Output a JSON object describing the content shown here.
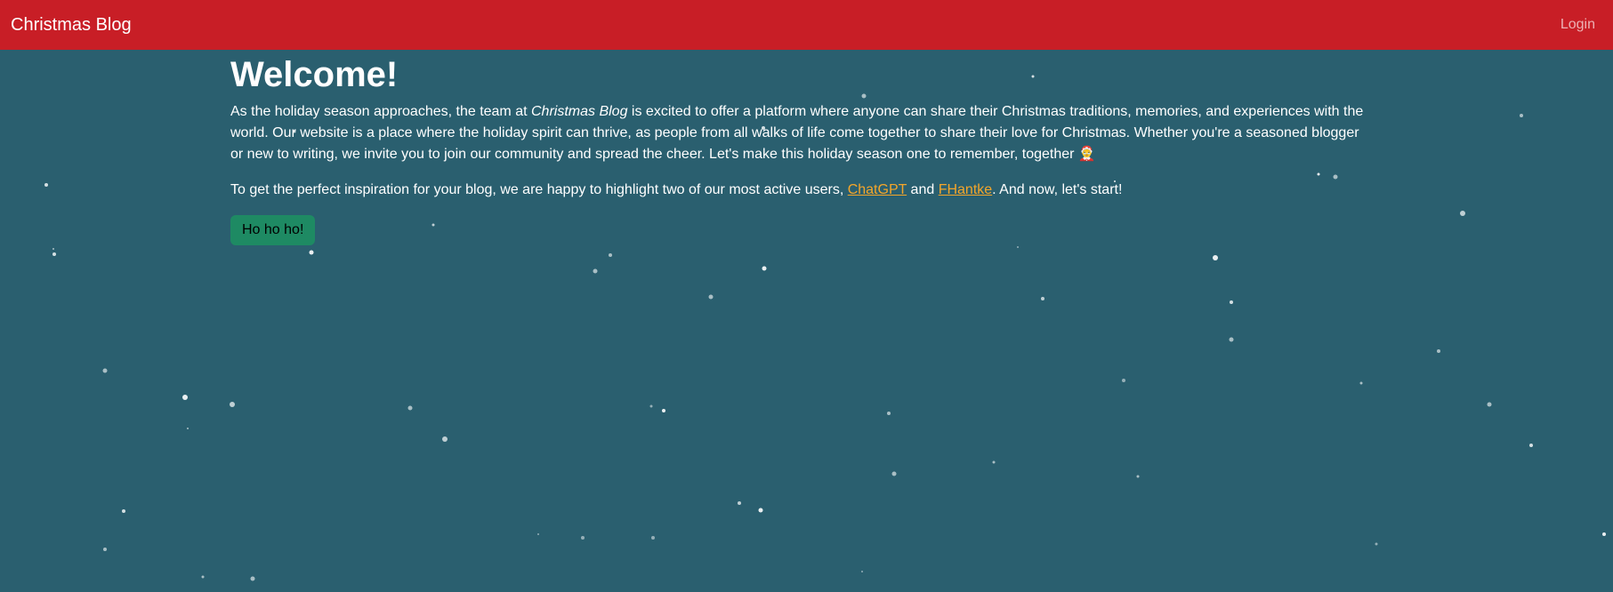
{
  "navbar": {
    "brand": "Christmas Blog",
    "login": "Login"
  },
  "main": {
    "heading": "Welcome!",
    "intro_part1": "As the holiday season approaches, the team at ",
    "intro_emphasis": "Christmas Blog",
    "intro_part2": " is excited to offer a platform where anyone can share their Christmas traditions, memories, and experiences with the world. Our website is a place where the holiday spirit can thrive, as people from all walks of life come together to share their love for Christmas. Whether you're a seasoned blogger or new to writing, we invite you to join our community and spread the cheer. Let's make this holiday season one to remember, together 🤶",
    "inspiration_part1": "To get the perfect inspiration for your blog, we are happy to highlight two of our most active users, ",
    "user1": "ChatGPT",
    "inspiration_and": " and ",
    "user2": "FHantke",
    "inspiration_part2": ". And now, let's start!",
    "button": "Ho ho ho!"
  },
  "colors": {
    "navbar": "#c81e26",
    "background": "#2a5f6f",
    "link": "#f4a62a",
    "button": "#1e8a63"
  }
}
